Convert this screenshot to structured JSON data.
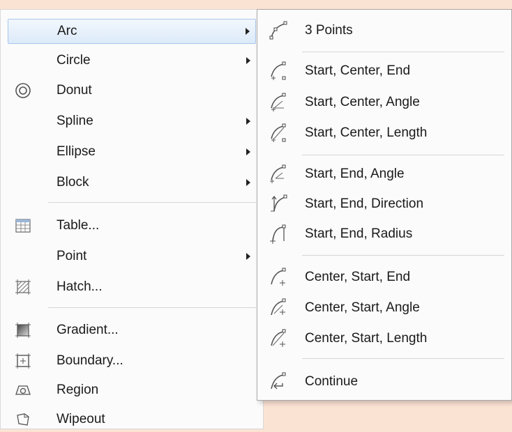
{
  "main_menu": {
    "items": [
      {
        "label": "Arc",
        "icon": "none",
        "submenu": true,
        "active": true
      },
      {
        "label": "Circle",
        "icon": "none",
        "submenu": true
      },
      {
        "label": "Donut",
        "icon": "donut-icon",
        "submenu": false
      },
      {
        "label": "Spline",
        "icon": "none",
        "submenu": true
      },
      {
        "label": "Ellipse",
        "icon": "none",
        "submenu": true
      },
      {
        "label": "Block",
        "icon": "none",
        "submenu": true
      },
      {
        "label": "Table...",
        "icon": "table-icon",
        "submenu": false
      },
      {
        "label": "Point",
        "icon": "none",
        "submenu": true
      },
      {
        "label": "Hatch...",
        "icon": "hatch-icon",
        "submenu": false
      },
      {
        "label": "Gradient...",
        "icon": "gradient-icon",
        "submenu": false
      },
      {
        "label": "Boundary...",
        "icon": "boundary-icon",
        "submenu": false
      },
      {
        "label": "Region",
        "icon": "region-icon",
        "submenu": false
      },
      {
        "label": "Wipeout",
        "icon": "wipeout-icon",
        "submenu": false
      }
    ]
  },
  "arc_submenu": {
    "items": [
      {
        "label": "3 Points",
        "icon": "arc-3-points-icon"
      },
      {
        "label": "Start, Center, End",
        "icon": "arc-start-center-end-icon"
      },
      {
        "label": "Start, Center, Angle",
        "icon": "arc-start-center-angle-icon"
      },
      {
        "label": "Start, Center, Length",
        "icon": "arc-start-center-length-icon"
      },
      {
        "label": "Start, End, Angle",
        "icon": "arc-start-end-angle-icon"
      },
      {
        "label": "Start, End, Direction",
        "icon": "arc-start-end-direction-icon"
      },
      {
        "label": "Start, End, Radius",
        "icon": "arc-start-end-radius-icon"
      },
      {
        "label": "Center, Start, End",
        "icon": "arc-center-start-end-icon"
      },
      {
        "label": "Center, Start, Angle",
        "icon": "arc-center-start-angle-icon"
      },
      {
        "label": "Center, Start, Length",
        "icon": "arc-center-start-length-icon"
      },
      {
        "label": "Continue",
        "icon": "arc-continue-icon"
      }
    ]
  },
  "colors": {
    "background": "#fbe3d4",
    "menu_background": "#fbfbfb",
    "highlight": "#dceaf9",
    "highlight_border": "#a7c6ea"
  }
}
